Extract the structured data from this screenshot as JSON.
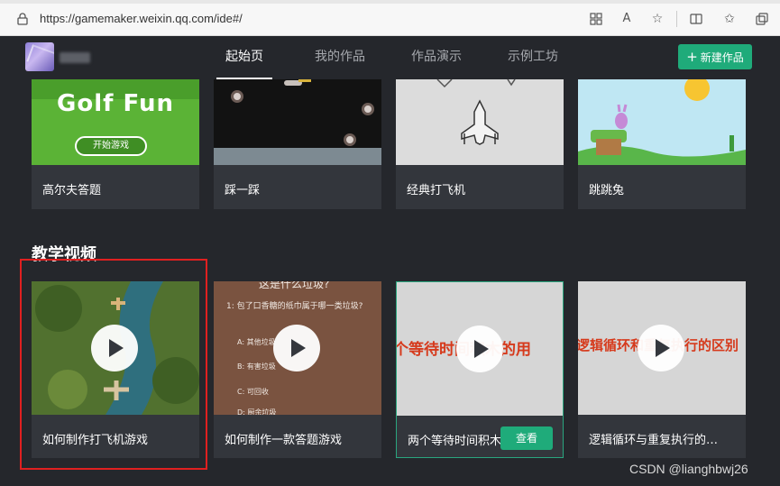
{
  "browser": {
    "url": "https://gamemaker.weixin.qq.com/ide#/",
    "icons": [
      "lock-icon",
      "app-grid-icon",
      "read-aloud-icon",
      "favorite-star-icon",
      "split-screen-icon",
      "favorites-list-icon",
      "collections-icon"
    ]
  },
  "header": {
    "nav": [
      "起始页",
      "我的作品",
      "作品演示",
      "示例工坊"
    ],
    "active_nav": "起始页",
    "new_button": "新建作品",
    "new_button_icon": "plus-icon",
    "accent_color": "#1fab7a"
  },
  "games": [
    {
      "title": "高尔夫答题",
      "thumb_text": "Golf Fun",
      "thumb_button": "开始游戏"
    },
    {
      "title": "踩一踩"
    },
    {
      "title": "经典打飞机"
    },
    {
      "title": "跳跳兔"
    }
  ],
  "section_title": "教学视频",
  "videos": [
    {
      "title": "如何制作打飞机游戏"
    },
    {
      "title": "如何制作一款答题游戏",
      "thumb_heading": "这是什么垃圾?",
      "thumb_question": "1: 包了口香糖的纸巾属于哪一类垃圾?",
      "thumb_options": [
        "A: 其他垃圾",
        "B: 有害垃圾",
        "C: 可回收",
        "D: 厨余垃圾"
      ]
    },
    {
      "title": "两个等待时间积木",
      "thumb_text": "个等待时间积木的用",
      "view_button": "查看"
    },
    {
      "title": "逻辑循环与重复执行的…",
      "thumb_text": "逻辑循环和重复执行的区别"
    }
  ],
  "watermark": "CSDN @lianghbwj26"
}
